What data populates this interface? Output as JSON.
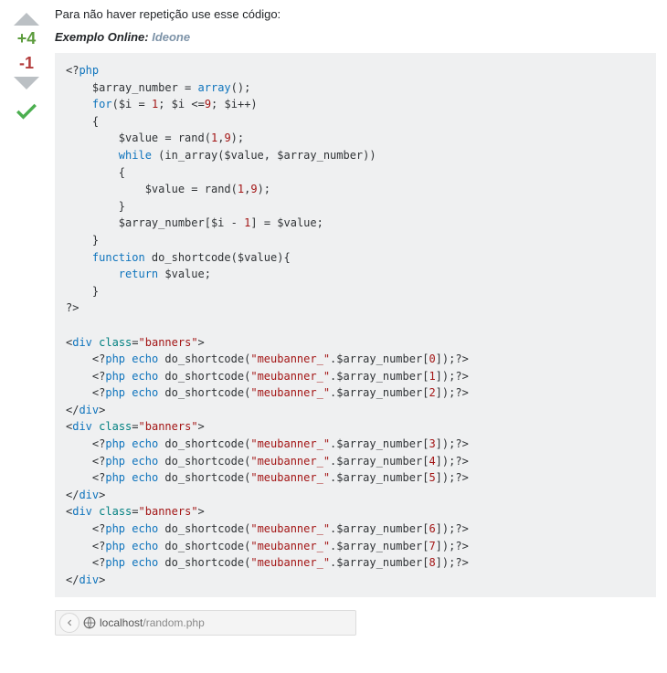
{
  "vote": {
    "positive": "+4",
    "negative": "-1"
  },
  "post": {
    "intro": "Para não haver repetição use esse código:",
    "example_label": "Exemplo Online:",
    "example_link_text": "Ideone"
  },
  "urlbar": {
    "host": "localhost",
    "path": "/random.php"
  }
}
